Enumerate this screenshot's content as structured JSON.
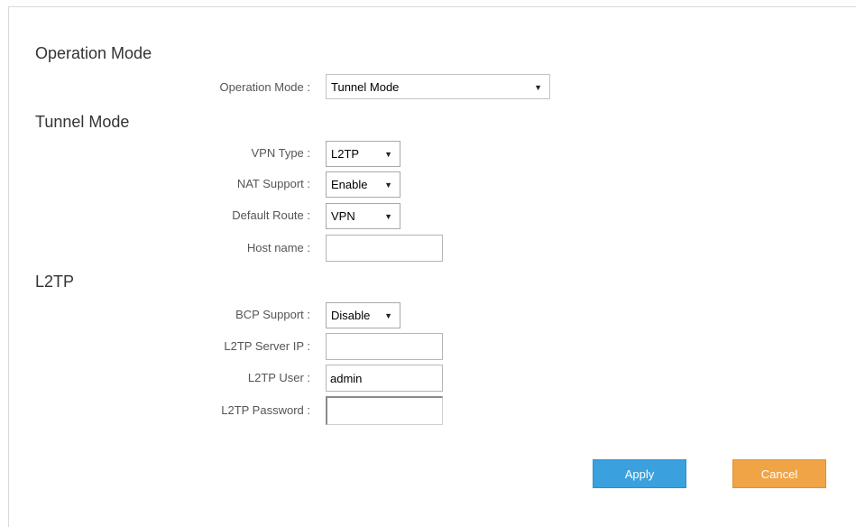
{
  "sections": {
    "operation_mode": "Operation Mode",
    "tunnel_mode": "Tunnel Mode",
    "l2tp": "L2TP"
  },
  "fields": {
    "operation_mode": {
      "label": "Operation Mode :",
      "value": "Tunnel Mode"
    },
    "vpn_type": {
      "label": "VPN Type :",
      "value": "L2TP"
    },
    "nat_support": {
      "label": "NAT Support :",
      "value": "Enable"
    },
    "default_route": {
      "label": "Default Route :",
      "value": "VPN"
    },
    "host_name": {
      "label": "Host name :",
      "value": ""
    },
    "bcp_support": {
      "label": "BCP Support :",
      "value": "Disable"
    },
    "l2tp_server_ip": {
      "label": "L2TP Server IP :",
      "value": ""
    },
    "l2tp_user": {
      "label": "L2TP User :",
      "value": "admin"
    },
    "l2tp_password": {
      "label": "L2TP Password :",
      "value": ""
    }
  },
  "buttons": {
    "apply": "Apply",
    "cancel": "Cancel"
  },
  "icons": {
    "dropdown": "chevron-down-icon"
  },
  "colors": {
    "apply": "#3ba0de",
    "cancel": "#f0a445"
  }
}
